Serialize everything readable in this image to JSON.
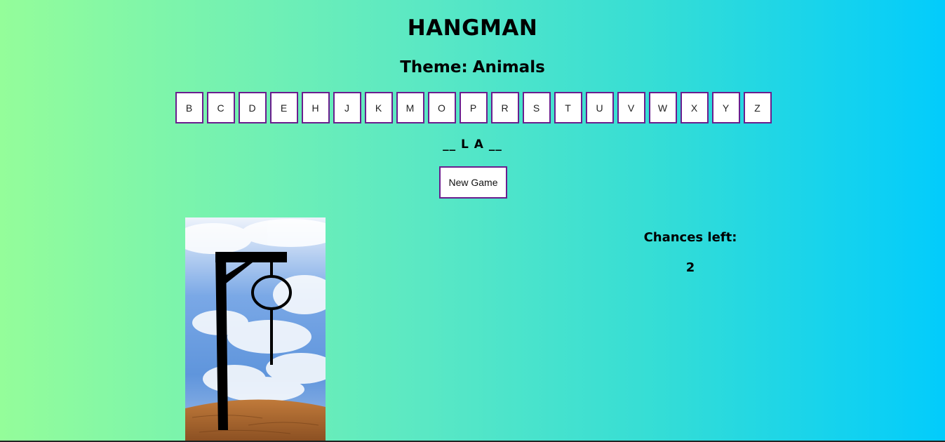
{
  "game": {
    "title": "HANGMAN",
    "theme_label": "Theme:",
    "theme_value": "Animals",
    "letters": [
      "B",
      "C",
      "D",
      "E",
      "H",
      "J",
      "K",
      "M",
      "O",
      "P",
      "R",
      "S",
      "T",
      "U",
      "V",
      "W",
      "X",
      "Y",
      "Z"
    ],
    "word_display": "__ L A __",
    "new_game_label": "New Game",
    "chances_label": "Chances left:",
    "chances_value": "2"
  },
  "colors": {
    "button_border": "#6a1e8e",
    "gradient_start": "#94fd9a",
    "gradient_end": "#02ccfc"
  },
  "icons": {
    "gallows": "gallows-with-noose-image"
  }
}
